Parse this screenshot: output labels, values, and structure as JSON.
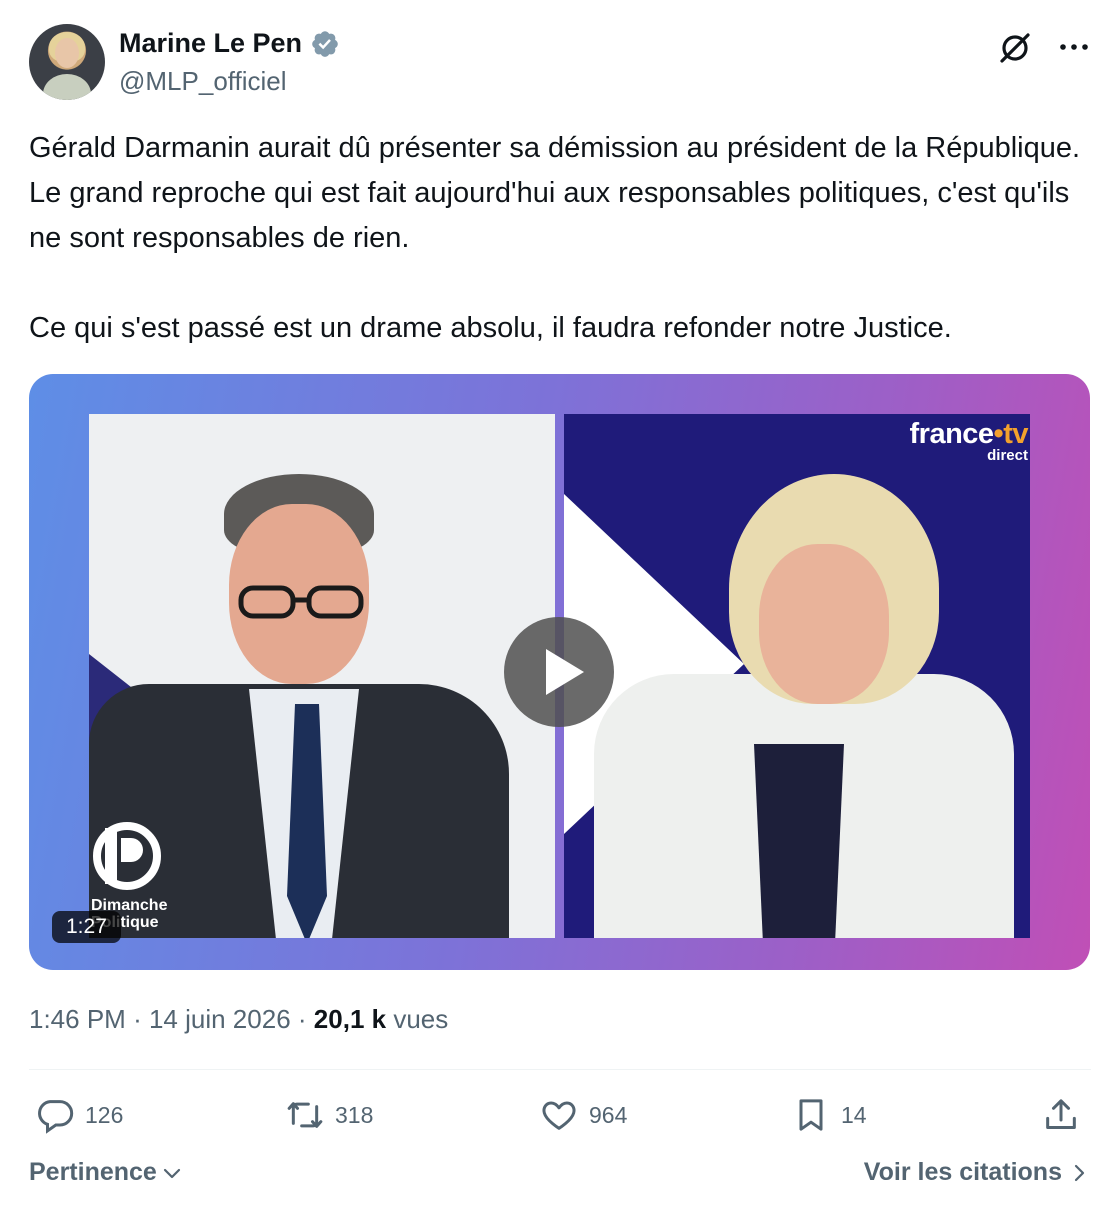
{
  "author": {
    "display_name": "Marine Le Pen",
    "handle": "@MLP_officiel"
  },
  "tweet": {
    "text": "Gérald Darmanin aurait dû présenter sa démission au président de la République. Le grand reproche qui est fait aujourd'hui aux responsables politiques, c'est qu'ils ne sont responsables de rien.\n\nCe qui s'est passé est un drame absolu, il faudra refonder notre Justice."
  },
  "media": {
    "channel_brand": "france",
    "channel_brand_dot": "•",
    "channel_brand_tv": "tv",
    "channel_sub": "direct",
    "show_line1": "Dimanche",
    "show_line2": "Politique",
    "duration": "1:27"
  },
  "meta": {
    "time": "1:46 PM",
    "separator": "·",
    "date": "14 juin 2026",
    "views_count": "20,1 k",
    "views_label": "vues"
  },
  "actions": {
    "replies": "126",
    "reposts": "318",
    "likes": "964",
    "bookmarks": "14"
  },
  "footer": {
    "sort_label": "Pertinence",
    "quotes_label": "Voir les citations"
  },
  "colors": {
    "text_primary": "#0f1419",
    "text_secondary": "#536471",
    "verified": "#829aab",
    "divider": "#eff3f4"
  },
  "icons": [
    "verified-badge-icon",
    "grok-icon",
    "more-icon",
    "play-icon",
    "reply-icon",
    "repost-icon",
    "like-icon",
    "bookmark-icon",
    "share-icon",
    "chevron-down-icon",
    "chevron-right-icon"
  ]
}
